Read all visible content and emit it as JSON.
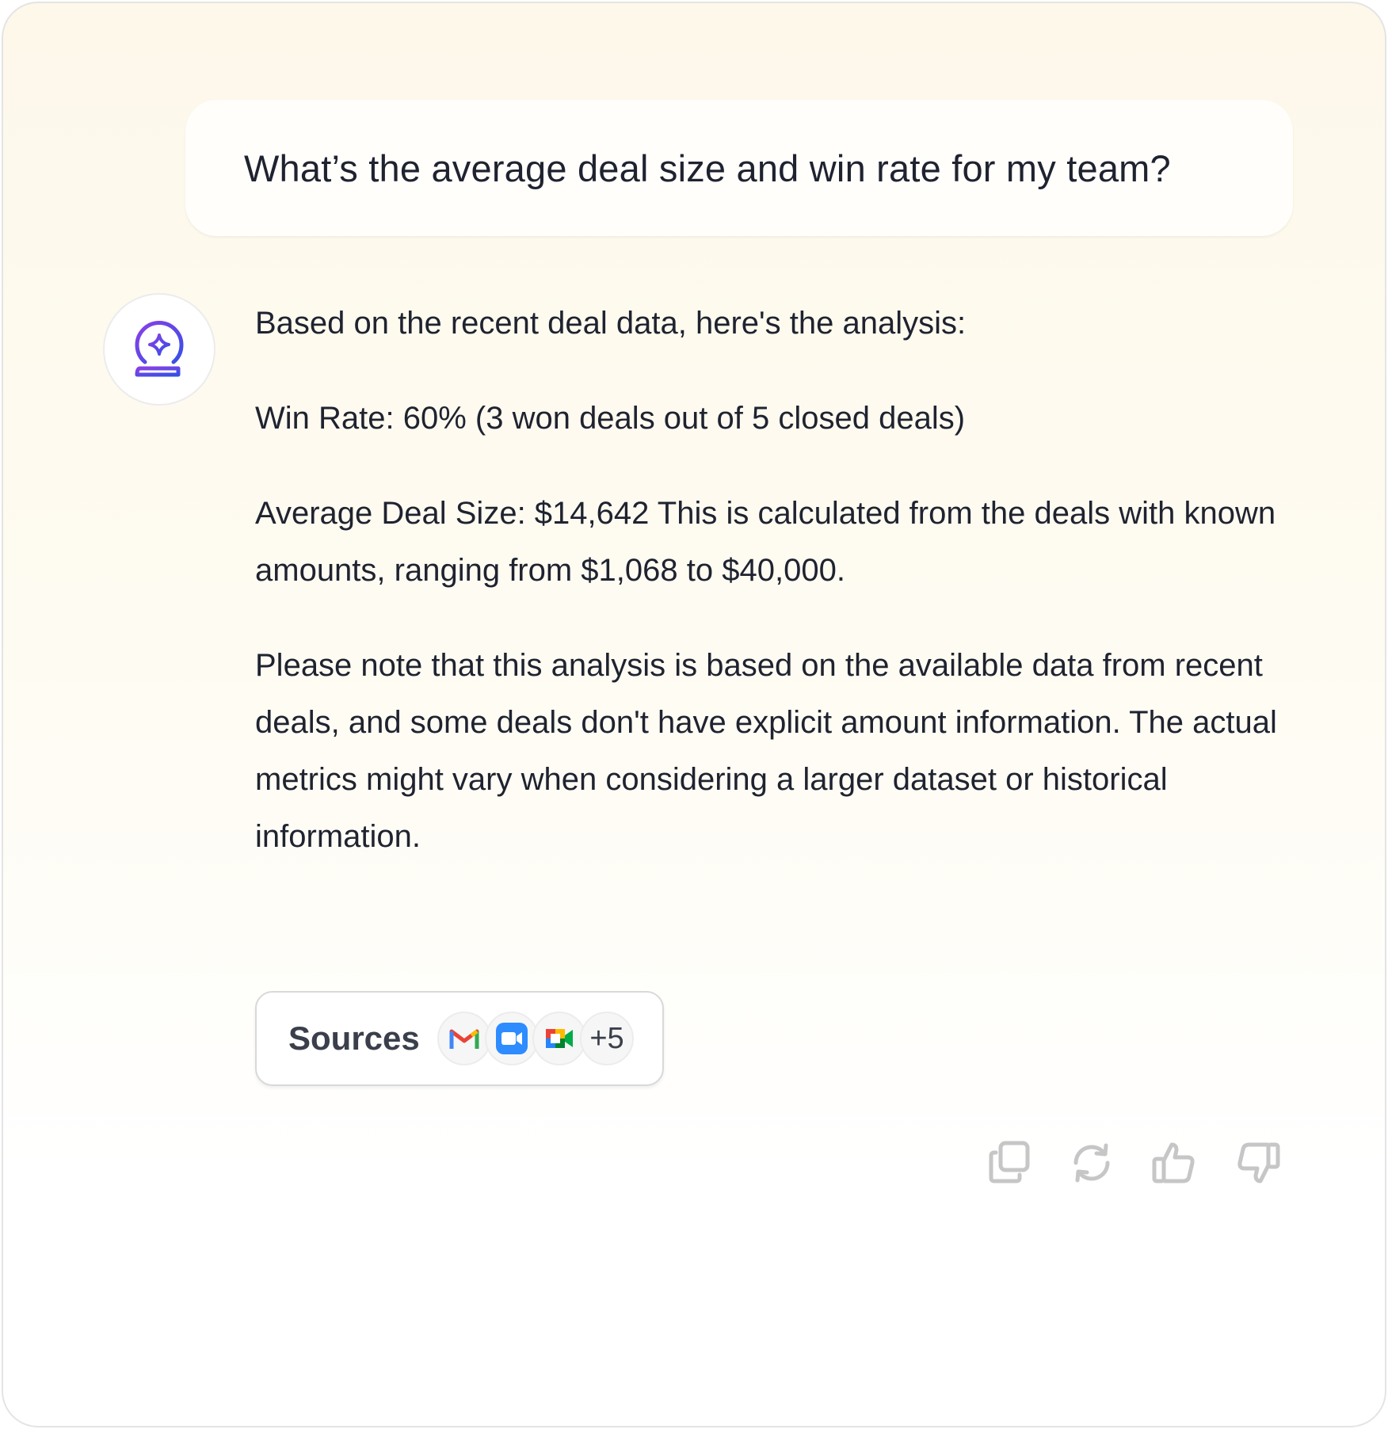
{
  "user_message": {
    "text": "What’s the average deal size and win rate for my team?"
  },
  "assistant": {
    "avatar_icon": "crystal-ball-sparkle-icon",
    "paragraphs": [
      "Based on the recent deal data, here's the analysis:",
      "Win Rate: 60% (3 won deals out of 5 closed deals)",
      "Average Deal Size: $14,642 This is calculated from the deals with known amounts, ranging from $1,068 to $40,000.",
      "Please note that this analysis is based on the available data from recent deals, and some deals don't have explicit amount information. The actual metrics might vary when considering a larger dataset or historical information."
    ]
  },
  "sources": {
    "label": "Sources",
    "icons": [
      "gmail-icon",
      "zoom-icon",
      "google-meet-icon"
    ],
    "more_count": "+5"
  },
  "actions": [
    "copy-icon",
    "regenerate-icon",
    "thumbs-up-icon",
    "thumbs-down-icon"
  ],
  "colors": {
    "accent_purple": "#7b3fe4",
    "accent_blue": "#3b4fe0",
    "zoom_blue": "#2d8cff"
  }
}
